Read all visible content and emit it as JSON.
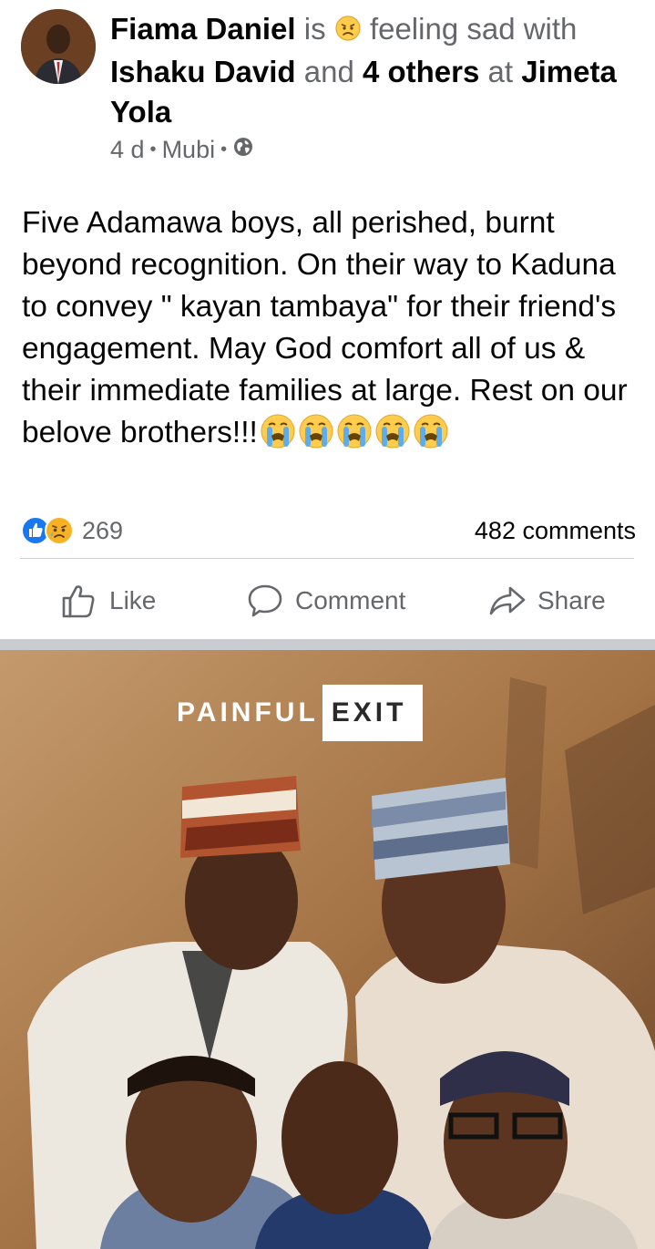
{
  "post": {
    "author": "Fiama Daniel",
    "is_word": "is",
    "feeling_text": "feeling sad with",
    "tagged_first": "Ishaku David",
    "and_word": "and",
    "tagged_others": "4 others",
    "at_word": "at",
    "location": "Jimeta Yola",
    "time": "4 d",
    "place": "Mubi",
    "body": "Five Adamawa  boys, all perished, burnt beyond recognition. On their way to Kaduna to convey \" kayan tambaya\" for their friend's engagement. May God comfort all of us & their immediate families at large. Rest on our belove brothers!!!",
    "body_emojis": [
      "loudly-crying-face",
      "loudly-crying-face",
      "loudly-crying-face",
      "loudly-crying-face",
      "loudly-crying-face"
    ],
    "feeling_icon": "sad-face-icon",
    "privacy_icon": "globe-icon"
  },
  "reactions": {
    "icons": [
      "like-icon",
      "sad-icon"
    ],
    "count": "269",
    "comments": "482 comments"
  },
  "actions": {
    "like": "Like",
    "comment": "Comment",
    "share": "Share"
  },
  "image": {
    "title_left": "PAINFUL",
    "title_right": "EXIT"
  },
  "colors": {
    "primary_text": "#050505",
    "secondary_text": "#65676b",
    "like_blue": "#1877f2",
    "emoji_yellow": "#f7b125",
    "separator": "#c9ccd1"
  }
}
